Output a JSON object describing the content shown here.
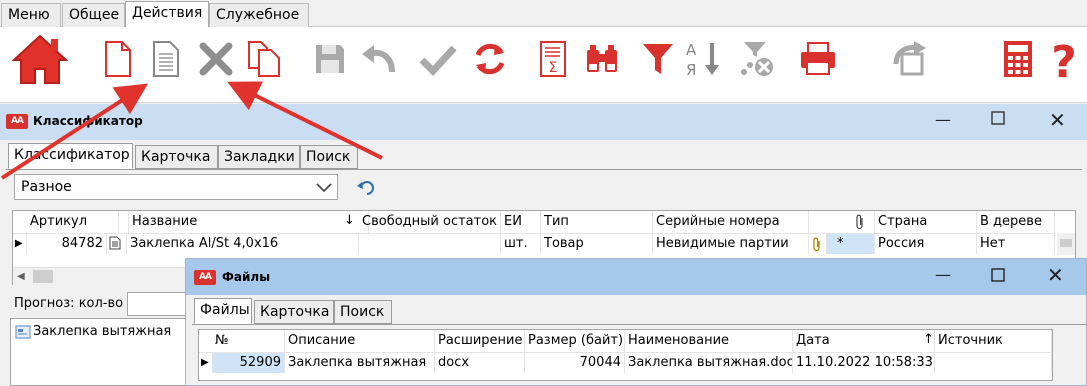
{
  "menu_tabs": [
    "Меню",
    "Общее",
    "Действия",
    "Служебное"
  ],
  "active_menu_tab": "Действия",
  "toolbar_icons": [
    "home-icon",
    "new-document-icon",
    "document-text-icon",
    "delete-icon",
    "copy-document-icon",
    "save-icon",
    "undo-icon",
    "confirm-check-icon",
    "refresh-icon",
    "sum-report-icon",
    "binoculars-icon",
    "filter-icon",
    "sort-az-icon",
    "clear-filter-icon",
    "print-icon",
    "redo-icon",
    "calculator-icon",
    "help-icon"
  ],
  "classifier": {
    "title": "Классификатор",
    "tabs": [
      "Классификатор",
      "Карточка",
      "Закладки",
      "Поиск"
    ],
    "dropdown_value": "Разное",
    "columns": [
      "Артикул",
      "Название",
      "Свободный остаток",
      "ЕИ",
      "Тип",
      "Серийные номера",
      "",
      "Страна",
      "В дереве"
    ],
    "row": {
      "article": "84782",
      "name": "Заклепка Al/St 4,0x16",
      "free_stock": "",
      "unit": "шт.",
      "type": "Товар",
      "serials": "Невидимые партии",
      "attach_mark": "*",
      "country": "Россия",
      "in_tree": "Нет"
    },
    "forecast_label": "Прогноз: кол-во",
    "tree_item": "Заклепка вытяжная"
  },
  "files": {
    "title": "Файлы",
    "tabs": [
      "Файлы",
      "Карточка",
      "Поиск"
    ],
    "columns": [
      "№",
      "Описание",
      "Расширение",
      "Размер (байт)",
      "Наименование",
      "Дата",
      "Источник"
    ],
    "row": {
      "no": "52909",
      "description": "Заклепка вытяжная",
      "extension": "docx",
      "size": "70044",
      "name": "Заклепка вытяжная.docx",
      "date": "11.10.2022 10:58:33",
      "source": ""
    }
  },
  "colors": {
    "accent_red": "#d9322e",
    "titlebar_blue": "#c9def3",
    "files_titlebar": "#a6c8ea",
    "selection": "#cfe4f7"
  }
}
